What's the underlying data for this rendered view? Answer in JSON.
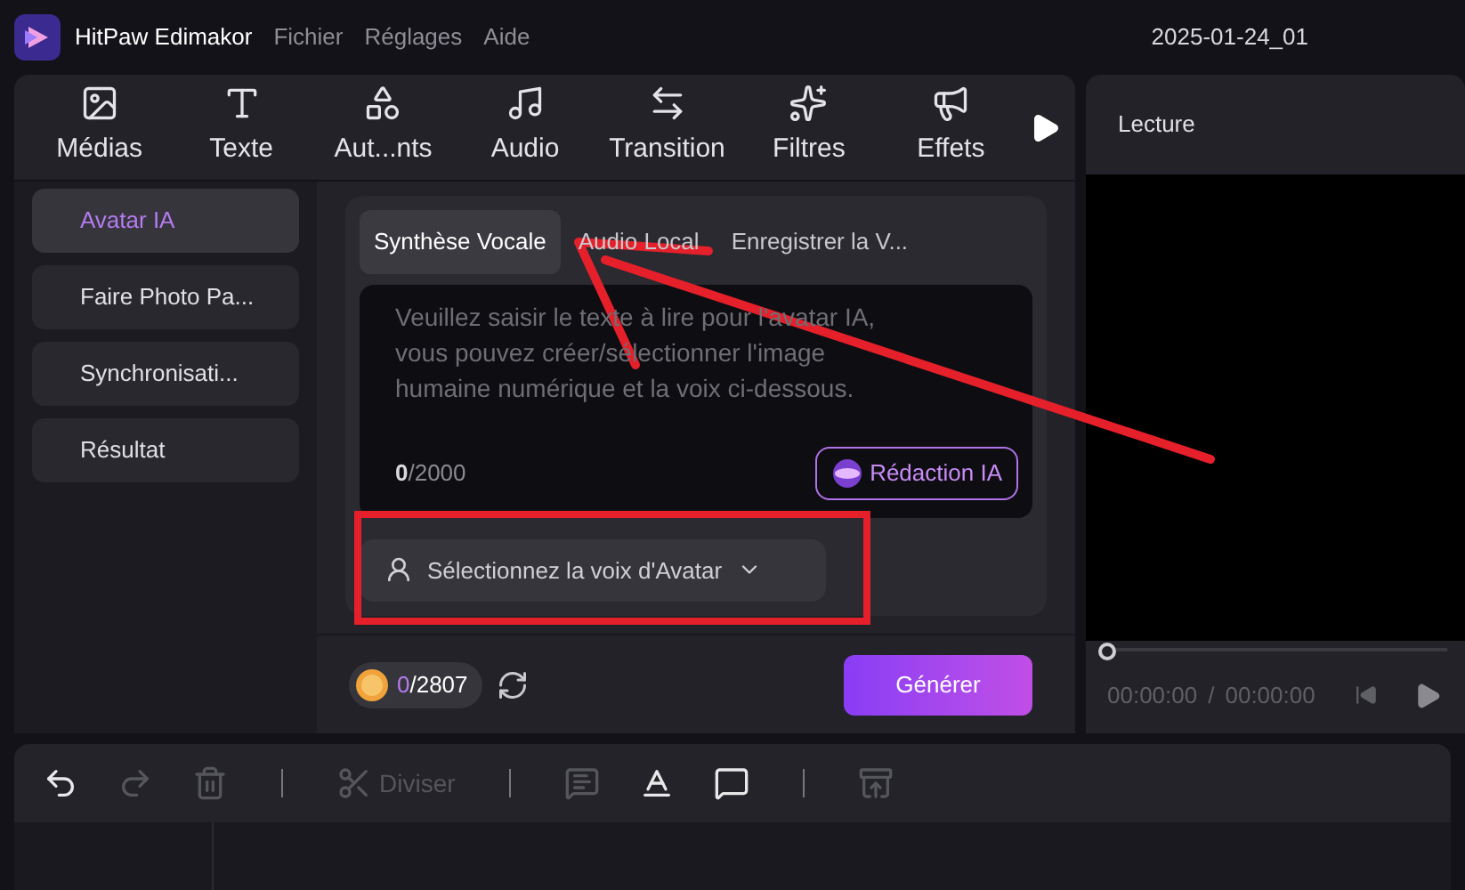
{
  "app": {
    "name": "HitPaw Edimakor",
    "menu": [
      "Fichier",
      "Réglages",
      "Aide"
    ],
    "project": "2025-01-24_01"
  },
  "tools": [
    {
      "label": "Médias"
    },
    {
      "label": "Texte"
    },
    {
      "label": "Aut...nts"
    },
    {
      "label": "Audio"
    },
    {
      "label": "Transition"
    },
    {
      "label": "Filtres"
    },
    {
      "label": "Effets"
    }
  ],
  "sidebar": {
    "items": [
      {
        "label": "Avatar IA",
        "selected": true
      },
      {
        "label": "Faire Photo Pa...",
        "selected": false
      },
      {
        "label": "Synchronisati...",
        "selected": false
      },
      {
        "label": "Résultat",
        "selected": false
      }
    ]
  },
  "tabs": [
    {
      "label": "Synthèse Vocale",
      "selected": true
    },
    {
      "label": "Audio Local",
      "selected": false
    },
    {
      "label": "Enregistrer la V...",
      "selected": false
    }
  ],
  "script_field": {
    "placeholder": "Veuillez saisir le texte à lire pour l'avatar IA, vous pouvez créer/sélectionner l'image humaine numérique et la voix ci-dessous.",
    "count": "0",
    "limit": "/2000"
  },
  "ai_write_button": "Rédaction IA",
  "voice_select": "Sélectionnez la voix d'Avatar",
  "credits": {
    "used": "0",
    "total": "/2807"
  },
  "generate_button": "Générer",
  "preview": {
    "title": "Lecture",
    "level": 0,
    "current": "00:00:00",
    "separator": "/",
    "duration": "00:00:00"
  },
  "edit_toolbar": [
    {
      "kind": "undo",
      "disabled": false
    },
    {
      "kind": "redo",
      "disabled": true
    },
    {
      "kind": "delete",
      "disabled": true
    },
    {
      "kind": "separator"
    },
    {
      "kind": "split",
      "label": "Diviser",
      "disabled": true
    },
    {
      "kind": "separator"
    },
    {
      "kind": "subtitle",
      "disabled": true
    },
    {
      "kind": "text",
      "disabled": false
    },
    {
      "kind": "ai",
      "disabled": false
    },
    {
      "kind": "separator"
    },
    {
      "kind": "export",
      "disabled": true
    }
  ],
  "annotations": {
    "arrow": true,
    "highlight_box": true
  }
}
